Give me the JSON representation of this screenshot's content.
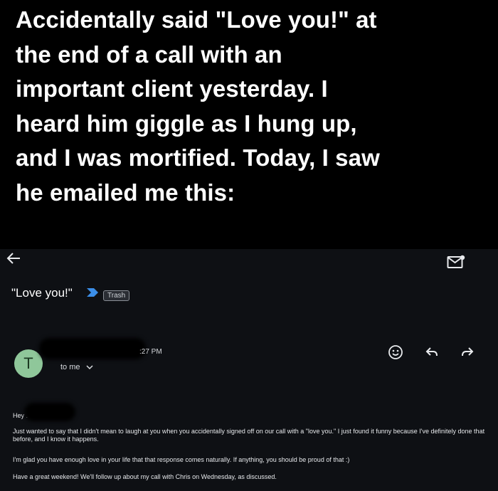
{
  "caption": {
    "lines": [
      "Accidentally said \"Love you!\" at",
      "the end of a call with an",
      "important client yesterday. I",
      "heard him giggle as I hung up,",
      "and I was mortified. Today, I saw",
      "he emailed me this:"
    ]
  },
  "email": {
    "subject": "\"Love you!\"",
    "label": "Trash",
    "avatar_letter": "T",
    "time": ":27 PM",
    "recipient": "to me",
    "greeting": "Hey .",
    "paragraphs": [
      "Just wanted to say that I didn't mean to laugh at you when you accidentally signed off on our call with a \"love you.\" I just found it funny because I've definitely done that before, and I know it happens.",
      "I'm glad you have enough love in your life that that response comes naturally. If anything, you should be proud of that :)",
      "Have a great weekend! We'll follow up about my call with Chris on Wednesday, as discussed."
    ]
  },
  "icons": {
    "back": "back-arrow-icon",
    "mark_unread": "mark-unread-icon",
    "important": "important-marker-icon",
    "emoji": "emoji-reaction-icon",
    "reply": "reply-icon",
    "forward": "forward-icon",
    "chevron": "chevron-down-icon"
  }
}
